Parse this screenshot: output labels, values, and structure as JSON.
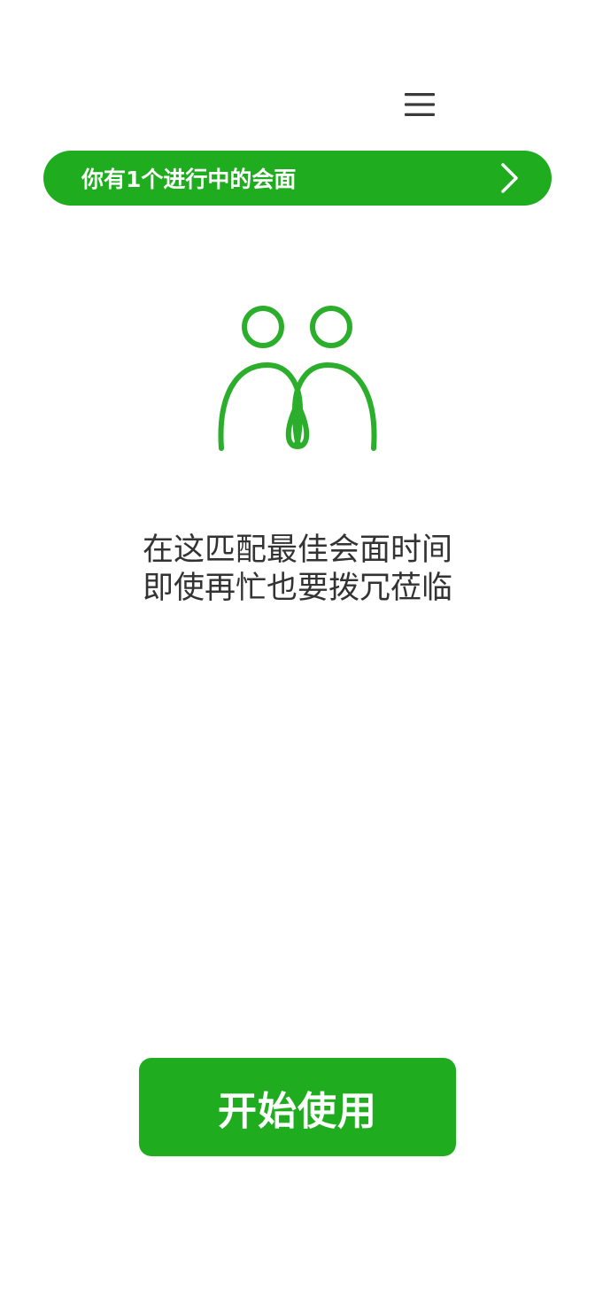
{
  "header": {
    "menu_icon": "hamburger-menu-icon"
  },
  "banner": {
    "text": "你有1个进行中的会面",
    "chevron_icon": "chevron-right-icon",
    "background_color": "#1FAD1F",
    "text_color": "#FFFFFF"
  },
  "illustration": {
    "icon": "two-people-icon",
    "stroke_color": "#2BAE2B"
  },
  "tagline": {
    "line1": "在这匹配最佳会面时间",
    "line2": "即使再忙也要拨冗莅临"
  },
  "start_button": {
    "label": "开始使用",
    "background_color": "#1FAD1F"
  },
  "colors": {
    "accent": "#1FAD1F",
    "text_primary": "#333333",
    "background": "#FFFFFF"
  }
}
